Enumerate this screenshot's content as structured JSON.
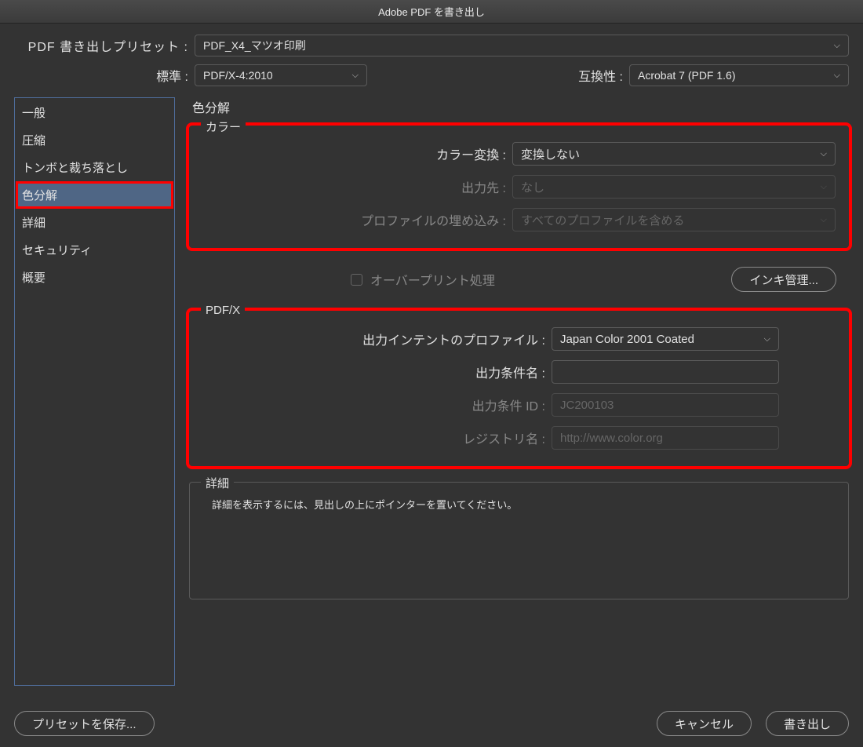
{
  "title": "Adobe PDF を書き出し",
  "preset": {
    "label": "PDF 書き出しプリセット :",
    "value": "PDF_X4_マツオ印刷"
  },
  "standard": {
    "label": "標準 :",
    "value": "PDF/X-4:2010"
  },
  "compatibility": {
    "label": "互換性 :",
    "value": "Acrobat 7 (PDF 1.6)"
  },
  "sidebar": {
    "items": [
      "一般",
      "圧縮",
      "トンボと裁ち落とし",
      "色分解",
      "詳細",
      "セキュリティ",
      "概要"
    ],
    "selected_index": 3
  },
  "panel_title": "色分解",
  "color_group": {
    "legend": "カラー",
    "conversion": {
      "label": "カラー変換 :",
      "value": "変換しない"
    },
    "output": {
      "label": "出力先 :",
      "value": "なし"
    },
    "profile_embed": {
      "label": "プロファイルの埋め込み :",
      "value": "すべてのプロファイルを含める"
    }
  },
  "overprint": {
    "label": "オーバープリント処理"
  },
  "ink_button": "インキ管理...",
  "pdfx_group": {
    "legend": "PDF/X",
    "intent_profile": {
      "label": "出力インテントのプロファイル :",
      "value": "Japan Color 2001 Coated"
    },
    "condition_name": {
      "label": "出力条件名 :",
      "value": ""
    },
    "condition_id": {
      "label": "出力条件 ID :",
      "value": "JC200103"
    },
    "registry": {
      "label": "レジストリ名 :",
      "value": "http://www.color.org"
    }
  },
  "detail_group": {
    "legend": "詳細",
    "text": "詳細を表示するには、見出しの上にポインターを置いてください。"
  },
  "footer": {
    "save_preset": "プリセットを保存...",
    "cancel": "キャンセル",
    "export": "書き出し"
  }
}
